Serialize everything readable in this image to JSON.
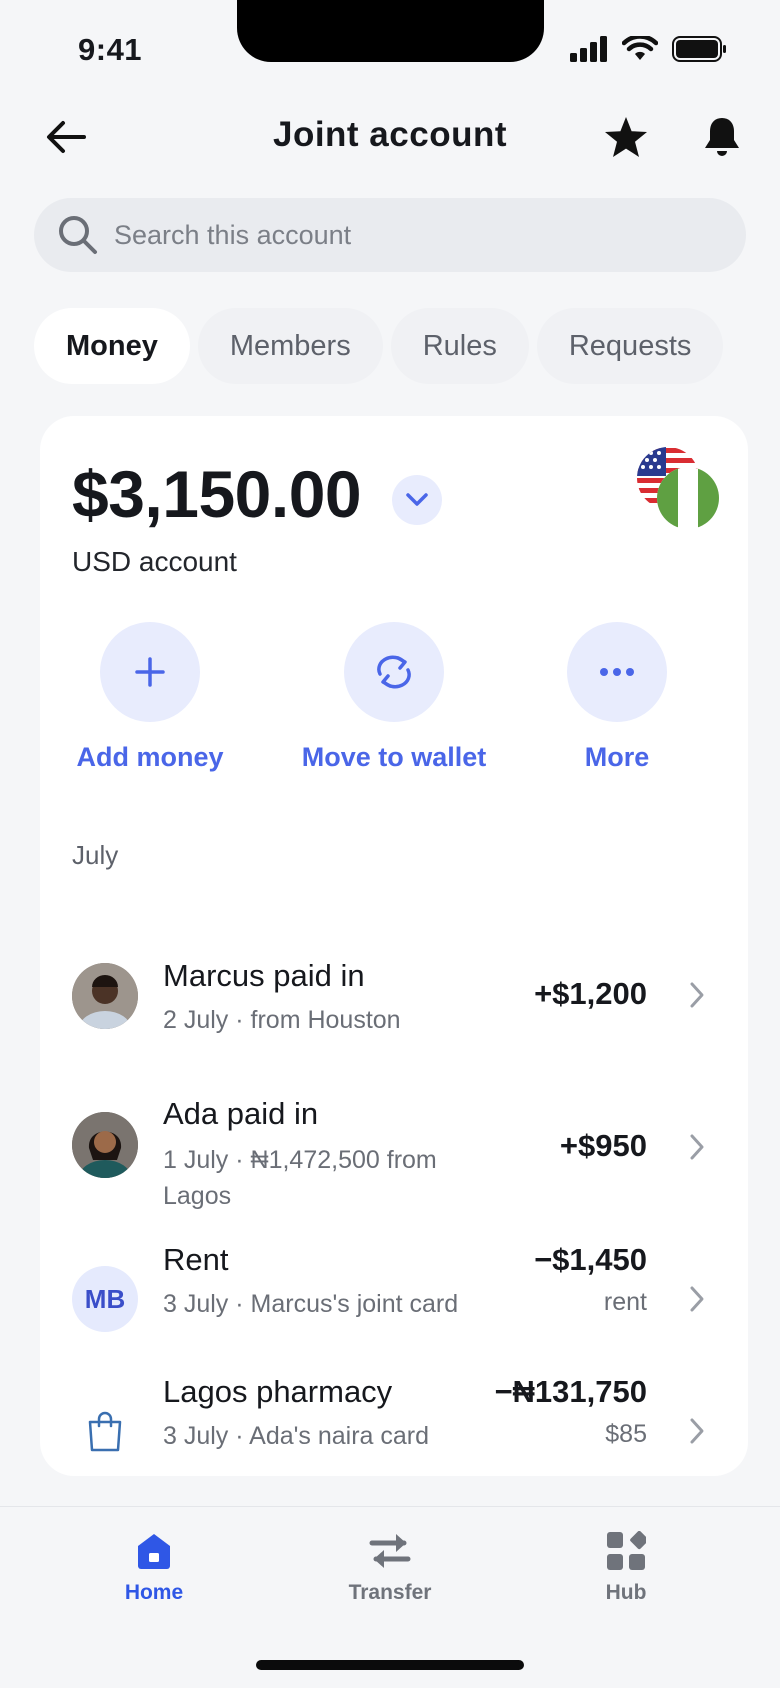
{
  "status_bar": {
    "time": "9:41"
  },
  "header": {
    "title": "Joint account"
  },
  "search": {
    "placeholder": "Search this account"
  },
  "tabs": [
    {
      "label": "Money",
      "active": true
    },
    {
      "label": "Members",
      "active": false
    },
    {
      "label": "Rules",
      "active": false
    },
    {
      "label": "Requests",
      "active": false
    }
  ],
  "account": {
    "balance": "$3,150.00",
    "label": "USD account",
    "flags": [
      "us-flag",
      "nigeria-flag"
    ]
  },
  "actions": [
    {
      "label": "Add money",
      "icon": "plus-icon"
    },
    {
      "label": "Move to wallet",
      "icon": "swap-icon"
    },
    {
      "label": "More",
      "icon": "more-icon"
    }
  ],
  "transactions": {
    "month": "July",
    "items": [
      {
        "title": "Marcus paid in",
        "subtitle": "2 July · from Houston",
        "amount": "+$1,200",
        "amount_sub": "",
        "avatar": "marcus-avatar"
      },
      {
        "title": "Ada paid in",
        "subtitle": "1 July · ₦1,472,500 from Lagos",
        "amount": "+$950",
        "amount_sub": "",
        "avatar": "ada-avatar"
      },
      {
        "title": "Rent",
        "subtitle": "3 July · Marcus's joint card",
        "amount": "−$1,450",
        "amount_sub": "rent",
        "initials": "MB"
      },
      {
        "title": "Lagos pharmacy",
        "subtitle": "3 July · Ada's naira card",
        "amount": "−₦131,750",
        "amount_sub": "$85",
        "icon": "shopping-bag-icon"
      }
    ]
  },
  "bottom_nav": [
    {
      "label": "Home",
      "active": true
    },
    {
      "label": "Transfer",
      "active": false
    },
    {
      "label": "Hub",
      "active": false
    }
  ],
  "colors": {
    "accent": "#4a66e8",
    "nav_active": "#2f57e6",
    "pill_bg": "#e8ecfd"
  }
}
